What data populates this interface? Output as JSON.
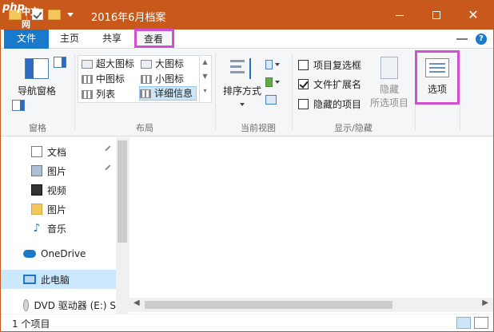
{
  "window": {
    "title": "2016年6月档案",
    "logo_text": "php",
    "logo_subtext": "中文网",
    "accent": "#c9591b",
    "highlight_color": "#d14fd1"
  },
  "tabs": [
    {
      "label": "文件"
    },
    {
      "label": "主页"
    },
    {
      "label": "共享"
    },
    {
      "label": "查看"
    }
  ],
  "ribbon": {
    "panes": {
      "nav_pane_label": "导航窗格",
      "group_label": "窗格"
    },
    "layout": {
      "items": [
        "超大图标",
        "大图标",
        "中图标",
        "小图标",
        "列表",
        "详细信息"
      ],
      "selected": "详细信息",
      "group_label": "布局"
    },
    "current_view": {
      "sort_label": "排序方式",
      "group_label": "当前视图"
    },
    "show_hide": {
      "checkboxes": [
        {
          "label": "项目复选框",
          "checked": false
        },
        {
          "label": "文件扩展名",
          "checked": true
        },
        {
          "label": "隐藏的项目",
          "checked": false
        }
      ],
      "hide_selected_line1": "隐藏",
      "hide_selected_line2": "所选项目",
      "group_label": "显示/隐藏"
    },
    "options_label": "选项"
  },
  "nav": {
    "items": [
      {
        "label": "文档",
        "icon": "document-icon",
        "pinned": true
      },
      {
        "label": "图片",
        "icon": "pictures-icon",
        "pinned": true
      },
      {
        "label": "视频",
        "icon": "video-icon",
        "pinned": false
      },
      {
        "label": "图片",
        "icon": "folder-icon",
        "pinned": false
      },
      {
        "label": "音乐",
        "icon": "music-icon",
        "pinned": false
      },
      {
        "label": "OneDrive",
        "icon": "onedrive-icon",
        "pinned": false
      },
      {
        "label": "此电脑",
        "icon": "this-pc-icon",
        "pinned": false
      },
      {
        "label": "DVD 驱动器 (E:) S",
        "icon": "dvd-icon",
        "pinned": false
      }
    ]
  },
  "status": {
    "item_count": "1 个项目"
  }
}
